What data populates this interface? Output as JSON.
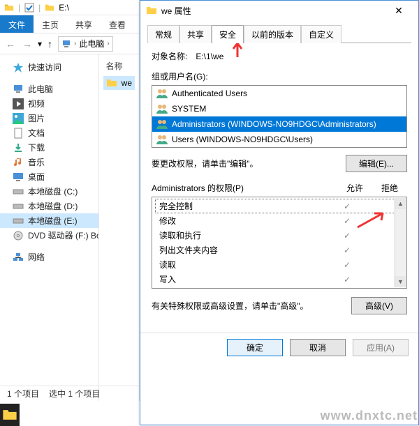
{
  "explorer": {
    "qat_path": "E:\\",
    "ribbon": {
      "file": "文件",
      "tabs": [
        "主页",
        "共享",
        "查看"
      ]
    },
    "breadcrumb": "此电脑",
    "content": {
      "column_name": "名称",
      "selected_folder": "we"
    },
    "tree": {
      "quick": "快速访问",
      "thispc": "此电脑",
      "items": [
        "视频",
        "图片",
        "文档",
        "下载",
        "音乐",
        "桌面",
        "本地磁盘 (C:)",
        "本地磁盘 (D:)",
        "本地磁盘 (E:)",
        "DVD 驱动器 (F:) Bo"
      ],
      "network": "网络"
    },
    "status": {
      "count": "1 个项目",
      "selected": "选中 1 个项目"
    }
  },
  "dialog": {
    "title": "we 属性",
    "close_tooltip": "关闭",
    "tabs": [
      "常规",
      "共享",
      "安全",
      "以前的版本",
      "自定义"
    ],
    "active_tab": 2,
    "object_label": "对象名称:",
    "object_value": "E:\\1\\we",
    "groups_label": "组或用户名(G):",
    "groups": [
      "Authenticated Users",
      "SYSTEM",
      "Administrators (WINDOWS-NO9HDGC\\Administrators)",
      "Users (WINDOWS-NO9HDGC\\Users)"
    ],
    "selected_group_index": 2,
    "edit_hint": "要更改权限，请单击\"编辑\"。",
    "edit_button": "编辑(E)...",
    "perm_title": "Administrators 的权限(P)",
    "perm_allow": "允许",
    "perm_deny": "拒绝",
    "permissions": [
      {
        "name": "完全控制",
        "allow": true,
        "deny": false
      },
      {
        "name": "修改",
        "allow": true,
        "deny": false
      },
      {
        "name": "读取和执行",
        "allow": true,
        "deny": false
      },
      {
        "name": "列出文件夹内容",
        "allow": true,
        "deny": false
      },
      {
        "name": "读取",
        "allow": true,
        "deny": false
      },
      {
        "name": "写入",
        "allow": true,
        "deny": false
      }
    ],
    "adv_hint": "有关特殊权限或高级设置，请单击\"高级\"。",
    "adv_button": "高级(V)",
    "ok": "确定",
    "cancel": "取消",
    "apply": "应用(A)"
  },
  "watermark": "www.dnxtc.net",
  "annotations": {
    "arrow1": "指向安全选项卡",
    "arrow2": "指向拒绝列"
  }
}
